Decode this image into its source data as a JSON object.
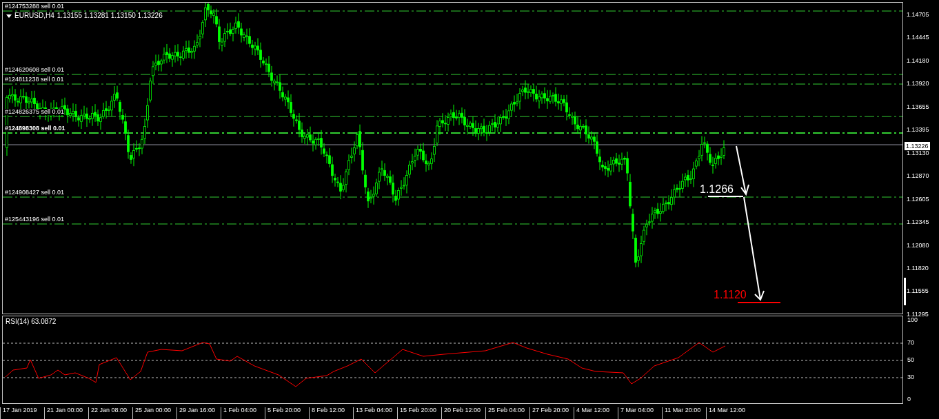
{
  "chart": {
    "symbol": "EURUSD,H4",
    "quote": "1.13155 1.13281 1.13150 1.13226",
    "orders": [
      {
        "label": "#124753288 sell 0.01"
      },
      {
        "label": "#124620608 sell 0.01"
      },
      {
        "label": "#124811238 sell 0.01"
      },
      {
        "label": "#124826375 sell 0.01"
      },
      {
        "label": "#124898308 sell 0.01"
      },
      {
        "label": "#124908427 sell 0.01"
      },
      {
        "label": "#125443196 sell 0.01"
      }
    ],
    "annotations": [
      {
        "text": "1.1266",
        "color": "#ffffff"
      },
      {
        "text": "1.1120",
        "color": "#ff0000"
      }
    ]
  },
  "price_axis": {
    "labels": [
      "1.14705",
      "1.14445",
      "1.14180",
      "1.13920",
      "1.13655",
      "1.13395",
      "1.13130",
      "1.12870",
      "1.12605",
      "1.12345",
      "1.12080",
      "1.11820",
      "1.11555",
      "1.11295"
    ],
    "current_price": "1.13226"
  },
  "rsi": {
    "title": "RSI(14) 63.0872",
    "axis_labels": [
      "100",
      "70",
      "50",
      "30",
      "0"
    ]
  },
  "time_axis": {
    "labels": [
      "17 Jan 2019",
      "21 Jan 00:00",
      "22 Jan 08:00",
      "25 Jan 00:00",
      "29 Jan 16:00",
      "1 Feb 04:00",
      "5 Feb 20:00",
      "8 Feb 12:00",
      "13 Feb 04:00",
      "15 Feb 20:00",
      "20 Feb 12:00",
      "25 Feb 04:00",
      "27 Feb 20:00",
      "4 Mar 12:00",
      "7 Mar 04:00",
      "11 Mar 20:00",
      "14 Mar 12:00"
    ]
  }
}
